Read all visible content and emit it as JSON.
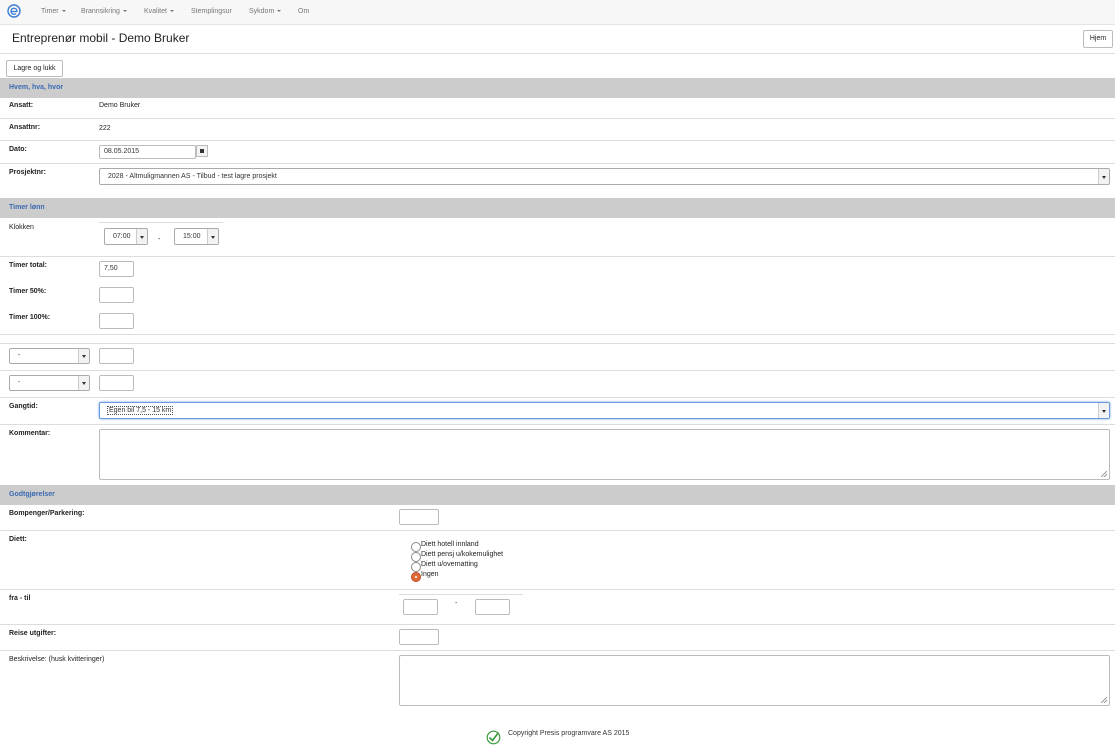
{
  "nav": {
    "items": [
      {
        "label": "Timer",
        "dropdown": true
      },
      {
        "label": "Brannsikring",
        "dropdown": true
      },
      {
        "label": "Kvalitet",
        "dropdown": true
      },
      {
        "label": "Stemplingsur",
        "dropdown": false
      },
      {
        "label": "Sykdom",
        "dropdown": true
      },
      {
        "label": "Om",
        "dropdown": false
      }
    ]
  },
  "header": {
    "title": "Entreprenør mobil - Demo Bruker",
    "home_button": "Hjem"
  },
  "toolbar": {
    "save_close_label": "Lagre og lukk"
  },
  "section_who": {
    "title": "Hvem, hva, hvor",
    "employee_label": "Ansatt:",
    "employee_value": "Demo Bruker",
    "employee_no_label": "Ansattnr:",
    "employee_no_value": "222",
    "date_label": "Dato:",
    "date_value": "08.05.2015",
    "project_label": "Prosjektnr:",
    "project_value": "2028 - Altmulig­mannen AS - Tilbud - test lagre prosjekt"
  },
  "section_hours": {
    "title": "Timer lønn",
    "clock_label": "Klokken",
    "from_time": "07:00",
    "separator": "-",
    "to_time": "15:00",
    "total_label": "Timer total:",
    "total_value": "7,50",
    "h50_label": "Timer 50%:",
    "h50_value": "",
    "h100_label": "Timer 100%:",
    "h100_value": "",
    "extra1_select": "-",
    "extra1_value": "",
    "extra2_select": "-",
    "extra2_value": "",
    "walk_label": "Gangtid:",
    "walk_value": "Egen bil 7,5 - 15 km",
    "comment_label": "Kommentar:",
    "comment_value": ""
  },
  "section_allowances": {
    "title": "Godtgjørelser",
    "toll_label": "Bompenger/Parkering:",
    "toll_value": "",
    "diet_label": "Diett:",
    "diet_options": [
      {
        "label": "Diett hotell innland",
        "selected": false
      },
      {
        "label": "Diett pensj u/kokemulighet",
        "selected": false
      },
      {
        "label": "Diett u/overnatting",
        "selected": false
      },
      {
        "label": "Ingen",
        "selected": true
      }
    ],
    "from_to_label": "fra - til",
    "from_to_separator": "-",
    "from_value": "",
    "to_value": "",
    "travel_label": "Reise utgifter:",
    "travel_value": "",
    "description_label": "Beskrivelse: (husk kvitteringer)",
    "description_value": ""
  },
  "footer": {
    "copyright": "Copyright Presis programvare AS 2015"
  },
  "colors": {
    "accent": "#3a6ab0",
    "section_bg": "#cccccc",
    "radio_selected": "#e06b3a",
    "footer_check": "#3a9a3a"
  },
  "icons": {
    "logo": "e-logo-icon",
    "calendar": "calendar-icon",
    "footer": "checkmark-icon"
  }
}
